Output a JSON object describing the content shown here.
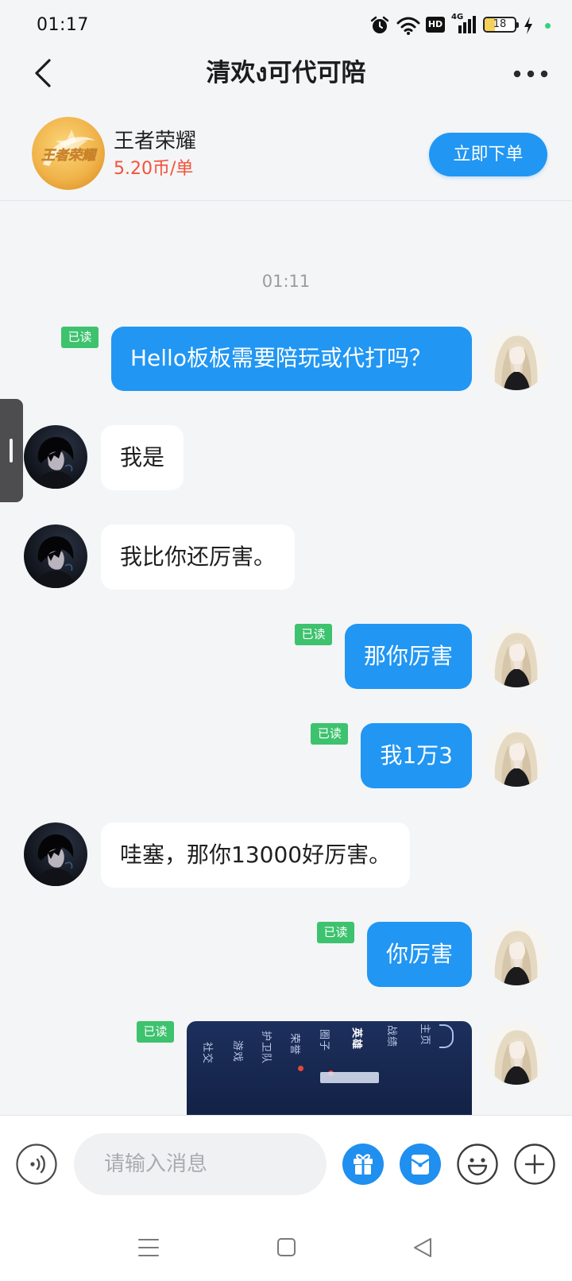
{
  "status_bar": {
    "time": "01:17",
    "hd": "HD",
    "network": "4G",
    "battery": "18",
    "icons": [
      "alarm-icon",
      "wifi-icon",
      "signal-icon",
      "charging-icon"
    ]
  },
  "header": {
    "title": "清欢ง可代可陪",
    "back_icon": "chevron-left-icon",
    "more_icon": "more-dots-icon"
  },
  "product": {
    "logo_text": "王者荣耀",
    "name": "王者荣耀",
    "price": "5.20币/单",
    "order_button": "立即下单"
  },
  "chat": {
    "timestamp": "01:11",
    "messages": [
      {
        "sender": "me",
        "text": "Hello板板需要陪玩或代打吗？",
        "status": "已读"
      },
      {
        "sender": "other",
        "text": "我是"
      },
      {
        "sender": "other",
        "text": "我比你还厉害。"
      },
      {
        "sender": "me",
        "text": "那你厉害",
        "status": "已读"
      },
      {
        "sender": "me",
        "text": "我1万3",
        "status": "已读"
      },
      {
        "sender": "other",
        "text": "哇塞，那你13000好厉害。"
      },
      {
        "sender": "me",
        "text": "你厉害",
        "status": "已读"
      }
    ],
    "image_message": {
      "sender": "me",
      "status": "已读",
      "labels": [
        "社交",
        "游戏",
        "护卫队",
        "荣誉",
        "圈子",
        "英雄",
        "战绩",
        "主页"
      ]
    }
  },
  "input": {
    "placeholder": "请输入消息",
    "value": "",
    "icons": [
      "voice-icon",
      "gift-icon",
      "red-packet-icon",
      "emoji-icon",
      "plus-icon"
    ]
  },
  "nav": {
    "icons": [
      "menu-icon",
      "home-icon",
      "back-icon"
    ]
  },
  "colors": {
    "accent": "#2196F3",
    "read_badge": "#3DC26E",
    "price": "#F4523B",
    "background": "#F4F5F7"
  }
}
